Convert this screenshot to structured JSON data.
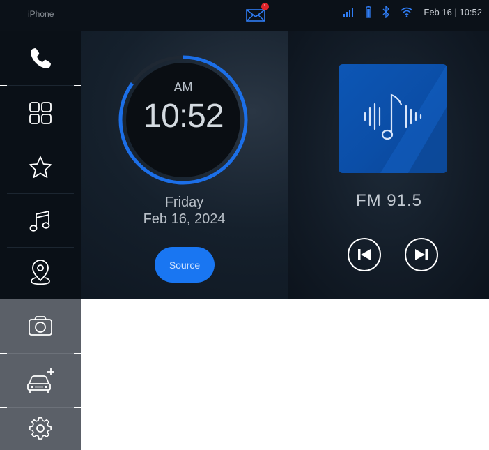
{
  "status_bar": {
    "device": "iPhone",
    "mail_badge": "1",
    "datetime": "Feb 16 | 10:52"
  },
  "sidebar": {
    "items": [
      {
        "name": "phone"
      },
      {
        "name": "apps"
      },
      {
        "name": "favorites"
      },
      {
        "name": "music"
      },
      {
        "name": "navigation"
      },
      {
        "name": "camera"
      },
      {
        "name": "add-vehicle"
      },
      {
        "name": "settings"
      }
    ]
  },
  "clock": {
    "period": "AM",
    "time": "10:52",
    "day": "Friday",
    "date": "Feb 16, 2024",
    "source_label": "Source"
  },
  "radio": {
    "frequency": "FM  91.5"
  },
  "colors": {
    "accent": "#1976f2",
    "sidebar_dark": "#0a1017",
    "sidebar_light": "#5b6068"
  }
}
